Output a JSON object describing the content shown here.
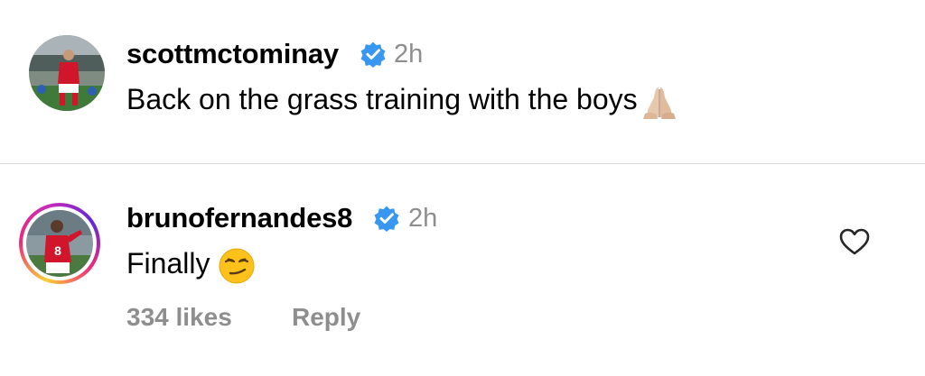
{
  "caption": {
    "username": "scottmctominay",
    "time": "2h",
    "text": "Back on the grass training with the boys",
    "emoji": "folded-hands-icon"
  },
  "comment": {
    "username": "brunofernandes8",
    "time": "2h",
    "text": "Finally",
    "emoji": "smirking-face-icon",
    "jersey_number": "8",
    "likes": "334 likes",
    "reply_label": "Reply"
  },
  "colors": {
    "verified_blue": "#3897f0",
    "secondary_text": "#8e8e8e",
    "divider": "#dbdbdb",
    "jersey_red": "#d1162b"
  }
}
